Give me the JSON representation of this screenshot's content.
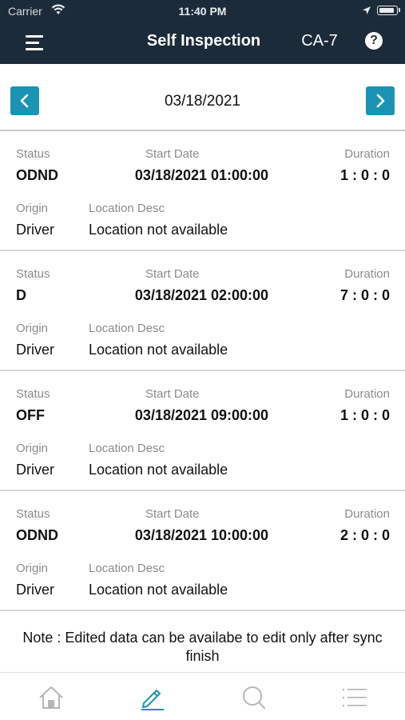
{
  "status_bar": {
    "carrier": "Carrier",
    "time": "11:40 PM",
    "battery_level": 0.9
  },
  "nav": {
    "title": "Self Inspection",
    "code": "CA-7",
    "help_label": "?",
    "menu_icon": "hamburger-menu-icon",
    "help_icon": "question-circle-icon"
  },
  "date_nav": {
    "date": "03/18/2021",
    "prev_icon": "chevron-left-icon",
    "next_icon": "chevron-right-icon",
    "accent_color": "#1b93b4"
  },
  "labels": {
    "status": "Status",
    "start_date": "Start Date",
    "duration": "Duration",
    "origin": "Origin",
    "location_desc": "Location Desc"
  },
  "records": [
    {
      "status": "ODND",
      "start_date": "03/18/2021 01:00:00",
      "duration": "1 : 0 : 0",
      "origin": "Driver",
      "location": "Location not available"
    },
    {
      "status": "D",
      "start_date": "03/18/2021 02:00:00",
      "duration": "7 : 0 : 0",
      "origin": "Driver",
      "location": "Location not available"
    },
    {
      "status": "OFF",
      "start_date": "03/18/2021 09:00:00",
      "duration": "1 : 0 : 0",
      "origin": "Driver",
      "location": "Location not available"
    },
    {
      "status": "ODND",
      "start_date": "03/18/2021 10:00:00",
      "duration": "2 : 0 : 0",
      "origin": "Driver",
      "location": "Location not available"
    }
  ],
  "note": "Note : Edited data can be availabe to edit only after sync finish",
  "tabs": [
    {
      "icon": "home-icon",
      "active": false
    },
    {
      "icon": "pencil-edit-icon",
      "active": true
    },
    {
      "icon": "search-icon",
      "active": false
    },
    {
      "icon": "list-icon",
      "active": false
    }
  ],
  "colors": {
    "header_bg": "#1c2b39",
    "tab_active": "#1b93b4",
    "tab_inactive": "#b5b5b5"
  }
}
